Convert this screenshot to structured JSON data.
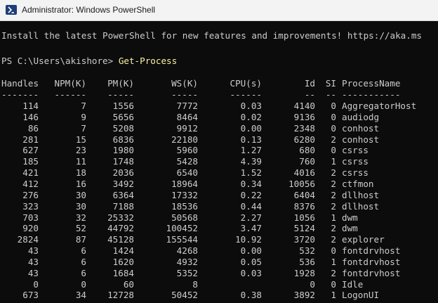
{
  "window": {
    "title": "Administrator: Windows PowerShell",
    "icon": "powershell-icon"
  },
  "terminal": {
    "banner": "Install the latest PowerShell for new features and improvements! https://aka.ms",
    "prompt": "PS C:\\Users\\akishore> ",
    "command": "Get-Process",
    "columns": [
      "Handles",
      "NPM(K)",
      "PM(K)",
      "WS(K)",
      "CPU(s)",
      "Id",
      "SI",
      "ProcessName"
    ],
    "underlines": [
      "-------",
      "------",
      "-----",
      "-----",
      "------",
      "--",
      "--",
      "-----------"
    ],
    "rows": [
      [
        "114",
        "7",
        "1556",
        "7772",
        "0.03",
        "4140",
        "0",
        "AggregatorHost"
      ],
      [
        "146",
        "9",
        "5656",
        "8464",
        "0.02",
        "9136",
        "0",
        "audiodg"
      ],
      [
        "86",
        "7",
        "5208",
        "9912",
        "0.00",
        "2348",
        "0",
        "conhost"
      ],
      [
        "281",
        "15",
        "6836",
        "22180",
        "0.13",
        "6280",
        "2",
        "conhost"
      ],
      [
        "627",
        "23",
        "1980",
        "5960",
        "1.27",
        "680",
        "0",
        "csrss"
      ],
      [
        "185",
        "11",
        "1748",
        "5428",
        "4.39",
        "760",
        "1",
        "csrss"
      ],
      [
        "421",
        "18",
        "2036",
        "6540",
        "1.52",
        "4016",
        "2",
        "csrss"
      ],
      [
        "412",
        "16",
        "3492",
        "18964",
        "0.34",
        "10056",
        "2",
        "ctfmon"
      ],
      [
        "276",
        "30",
        "6364",
        "17332",
        "0.22",
        "6404",
        "2",
        "dllhost"
      ],
      [
        "323",
        "30",
        "7188",
        "18536",
        "0.44",
        "8376",
        "2",
        "dllhost"
      ],
      [
        "703",
        "32",
        "25332",
        "50568",
        "2.27",
        "1056",
        "1",
        "dwm"
      ],
      [
        "920",
        "52",
        "44792",
        "100452",
        "3.47",
        "5124",
        "2",
        "dwm"
      ],
      [
        "2824",
        "87",
        "45128",
        "155544",
        "10.92",
        "3720",
        "2",
        "explorer"
      ],
      [
        "43",
        "6",
        "1424",
        "4268",
        "0.00",
        "532",
        "0",
        "fontdrvhost"
      ],
      [
        "43",
        "6",
        "1620",
        "4932",
        "0.05",
        "536",
        "1",
        "fontdrvhost"
      ],
      [
        "43",
        "6",
        "1684",
        "5352",
        "0.03",
        "1928",
        "2",
        "fontdrvhost"
      ],
      [
        "0",
        "0",
        "60",
        "8",
        "",
        "0",
        "0",
        "Idle"
      ],
      [
        "673",
        "34",
        "12728",
        "50452",
        "0.38",
        "3892",
        "1",
        "LogonUI"
      ]
    ]
  }
}
